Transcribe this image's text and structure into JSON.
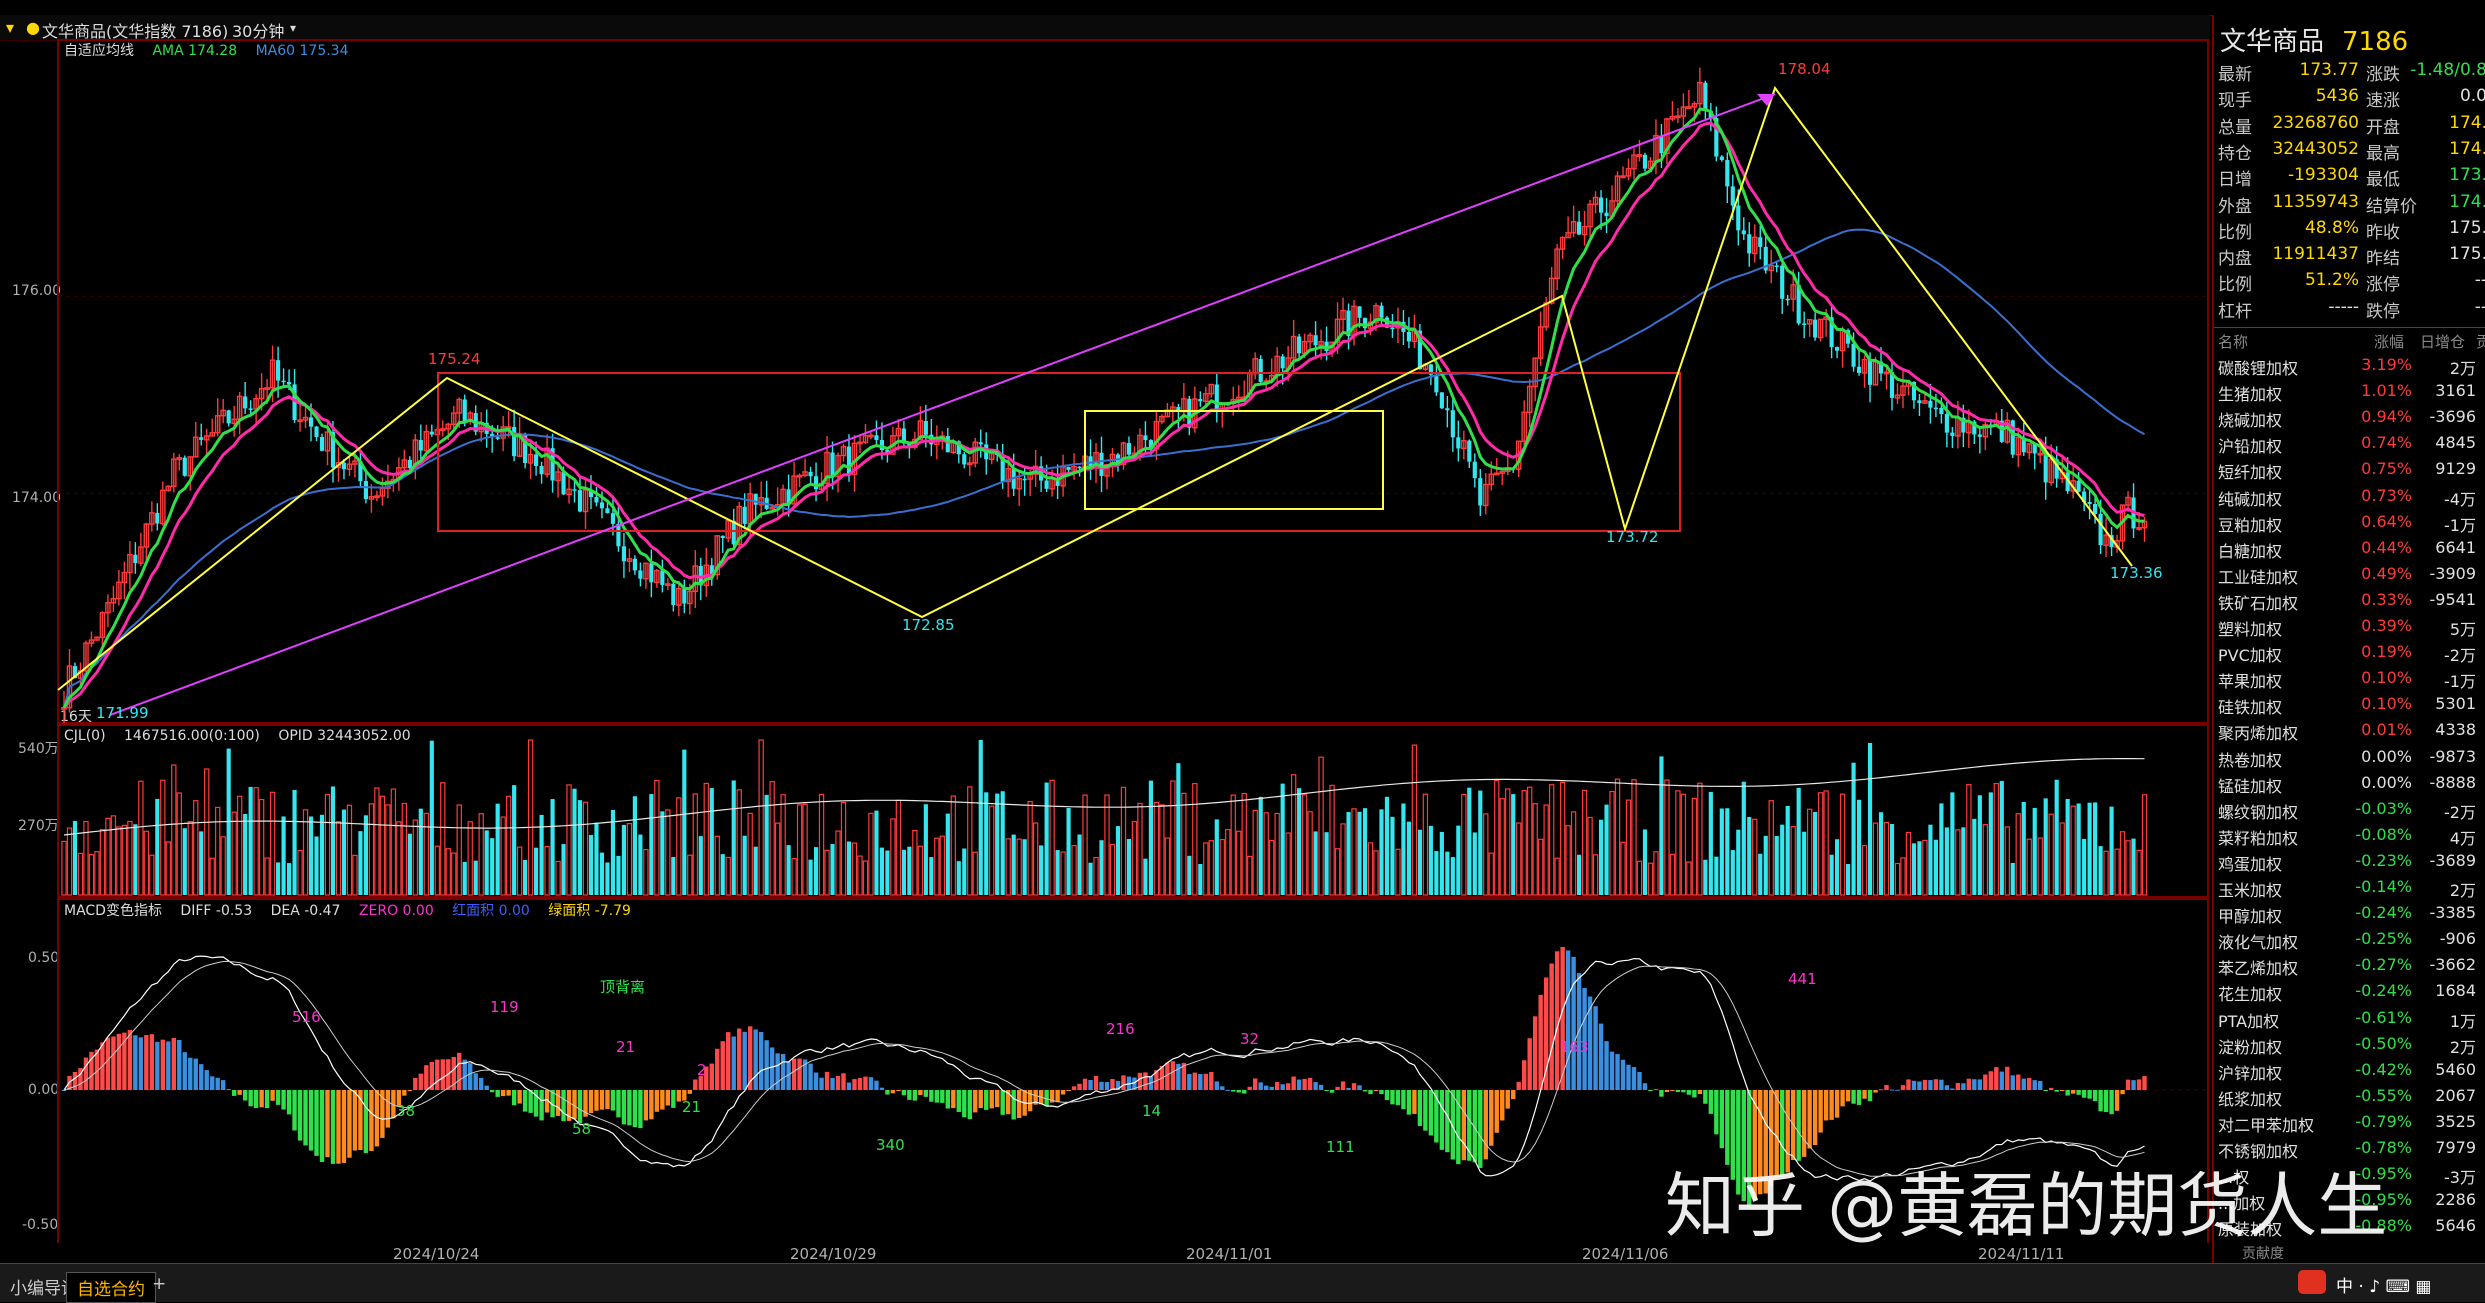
{
  "titlebar": {
    "symbol": "文华商品(文华指数 7186)",
    "period": "30分钟"
  },
  "main_legend": {
    "mode": "自适应均线",
    "ama": "AMA 174.28",
    "ma60": "MA60 175.34"
  },
  "vol_legend": {
    "cjl": "CJL(0)",
    "vol": "1467516.00(0:100)",
    "opid": "OPID 32443052.00"
  },
  "macd_legend": {
    "name": "MACD变色指标",
    "diff": "DIFF -0.53",
    "dea": "DEA -0.47",
    "zero": "ZERO 0.00",
    "red": "红面积 0.00",
    "green": "绿面积 -7.79"
  },
  "price_axis": [
    "176.00",
    "174.00"
  ],
  "vol_axis": [
    "540万",
    "270万"
  ],
  "macd_axis": [
    "0.50",
    "0.00",
    "-0.50"
  ],
  "period_tag": "16天",
  "annotations": {
    "p1": "171.99",
    "p2": "175.24",
    "p3": "172.85",
    "p4": "178.04",
    "p5": "173.72",
    "p6": "173.36",
    "m1": "516",
    "m2": "119",
    "m3": "顶背离",
    "m4": "21",
    "m5": "2",
    "m6": "38",
    "m7": "58",
    "m8": "21",
    "m9": "340",
    "m10": "216",
    "m11": "14",
    "m12": "32",
    "m13": "111",
    "m14": "163",
    "m15": "441"
  },
  "dates": [
    "2024/10/24",
    "2024/10/29",
    "2024/11/01",
    "2024/11/06",
    "2024/11/11"
  ],
  "quote": {
    "title": "文华商品",
    "code": "7186",
    "rows": [
      {
        "l": "最新",
        "v": "173.77",
        "vc": "#ffd800",
        "l2": "涨跌",
        "v2": "-1.48/0.8",
        "v2c": "#2fe04a"
      },
      {
        "l": "现手",
        "v": "5436",
        "vc": "#ffd800",
        "l2": "速涨",
        "v2": "0.0",
        "v2c": "#e0e0e0"
      },
      {
        "l": "总量",
        "v": "23268760",
        "vc": "#ffd800",
        "l2": "开盘",
        "v2": "174.",
        "v2c": "#ffd800"
      },
      {
        "l": "持仓",
        "v": "32443052",
        "vc": "#ffd800",
        "l2": "最高",
        "v2": "174.",
        "v2c": "#ffd800"
      },
      {
        "l": "日增",
        "v": "-193304",
        "vc": "#ffd800",
        "l2": "最低",
        "v2": "173.",
        "v2c": "#2fe04a"
      },
      {
        "l": "外盘",
        "v": "11359743",
        "vc": "#ffd800",
        "l2": "结算价",
        "v2": "174.",
        "v2c": "#2fe04a"
      },
      {
        "l": "比例",
        "v": "48.8%",
        "vc": "#ffd800",
        "l2": "昨收",
        "v2": "175.",
        "v2c": "#e0e0e0"
      },
      {
        "l": "内盘",
        "v": "11911437",
        "vc": "#ffd800",
        "l2": "昨结",
        "v2": "175.",
        "v2c": "#e0e0e0"
      },
      {
        "l": "比例",
        "v": "51.2%",
        "vc": "#ffd800",
        "l2": "涨停",
        "v2": "--",
        "v2c": "#e0e0e0"
      },
      {
        "l": "杠杆",
        "v": "-----",
        "vc": "#e0e0e0",
        "l2": "跌停",
        "v2": "--",
        "v2c": "#e0e0e0"
      }
    ]
  },
  "watchlist": {
    "headers": [
      "名称",
      "涨幅",
      "日增仓",
      "贡"
    ],
    "rows": [
      {
        "n": "碳酸锂加权",
        "c": "3.19%",
        "h": "2万",
        "cc": "#ff3a3a"
      },
      {
        "n": "生猪加权",
        "c": "1.01%",
        "h": "3161",
        "cc": "#ff3a3a"
      },
      {
        "n": "烧碱加权",
        "c": "0.94%",
        "h": "-3696",
        "cc": "#ff3a3a"
      },
      {
        "n": "沪铅加权",
        "c": "0.74%",
        "h": "4845",
        "cc": "#ff3a3a"
      },
      {
        "n": "短纤加权",
        "c": "0.75%",
        "h": "9129",
        "cc": "#ff3a3a"
      },
      {
        "n": "纯碱加权",
        "c": "0.73%",
        "h": "-4万",
        "cc": "#ff3a3a"
      },
      {
        "n": "豆粕加权",
        "c": "0.64%",
        "h": "-1万",
        "cc": "#ff3a3a"
      },
      {
        "n": "白糖加权",
        "c": "0.44%",
        "h": "6641",
        "cc": "#ff3a3a"
      },
      {
        "n": "工业硅加权",
        "c": "0.49%",
        "h": "-3909",
        "cc": "#ff3a3a"
      },
      {
        "n": "铁矿石加权",
        "c": "0.33%",
        "h": "-9541",
        "cc": "#ff3a3a"
      },
      {
        "n": "塑料加权",
        "c": "0.39%",
        "h": "5万",
        "cc": "#ff3a3a"
      },
      {
        "n": "PVC加权",
        "c": "0.19%",
        "h": "-2万",
        "cc": "#ff3a3a"
      },
      {
        "n": "苹果加权",
        "c": "0.10%",
        "h": "-1万",
        "cc": "#ff3a3a"
      },
      {
        "n": "硅铁加权",
        "c": "0.10%",
        "h": "5301",
        "cc": "#ff3a3a"
      },
      {
        "n": "聚丙烯加权",
        "c": "0.01%",
        "h": "4338",
        "cc": "#ff3a3a"
      },
      {
        "n": "热卷加权",
        "c": "0.00%",
        "h": "-9873",
        "cc": "#e0e0e0"
      },
      {
        "n": "锰硅加权",
        "c": "0.00%",
        "h": "-8888",
        "cc": "#e0e0e0"
      },
      {
        "n": "螺纹钢加权",
        "c": "-0.03%",
        "h": "-2万",
        "cc": "#2fe04a"
      },
      {
        "n": "菜籽粕加权",
        "c": "-0.08%",
        "h": "4万",
        "cc": "#2fe04a"
      },
      {
        "n": "鸡蛋加权",
        "c": "-0.23%",
        "h": "-3689",
        "cc": "#2fe04a"
      },
      {
        "n": "玉米加权",
        "c": "-0.14%",
        "h": "2万",
        "cc": "#2fe04a"
      },
      {
        "n": "甲醇加权",
        "c": "-0.24%",
        "h": "-3385",
        "cc": "#2fe04a"
      },
      {
        "n": "液化气加权",
        "c": "-0.25%",
        "h": "-906",
        "cc": "#2fe04a"
      },
      {
        "n": "苯乙烯加权",
        "c": "-0.27%",
        "h": "-3662",
        "cc": "#2fe04a"
      },
      {
        "n": "花生加权",
        "c": "-0.24%",
        "h": "1684",
        "cc": "#2fe04a"
      },
      {
        "n": "PTA加权",
        "c": "-0.61%",
        "h": "1万",
        "cc": "#2fe04a"
      },
      {
        "n": "淀粉加权",
        "c": "-0.50%",
        "h": "2万",
        "cc": "#2fe04a"
      },
      {
        "n": "沪锌加权",
        "c": "-0.42%",
        "h": "5460",
        "cc": "#2fe04a"
      },
      {
        "n": "纸浆加权",
        "c": "-0.55%",
        "h": "2067",
        "cc": "#2fe04a"
      },
      {
        "n": "对二甲苯加权",
        "c": "-0.79%",
        "h": "3525",
        "cc": "#2fe04a"
      },
      {
        "n": "不锈钢加权",
        "c": "-0.78%",
        "h": "7979",
        "cc": "#2fe04a"
      },
      {
        "n": "...权",
        "c": "-0.95%",
        "h": "-3万",
        "cc": "#2fe04a"
      },
      {
        "n": "...加权",
        "c": "-0.95%",
        "h": "2286",
        "cc": "#2fe04a"
      },
      {
        "n": "原装加权",
        "c": "-0.88%",
        "h": "5646",
        "cc": "#2fe04a"
      }
    ],
    "footer": "贡献度"
  },
  "bottom_tabs": [
    "小编导读",
    "自选合约",
    "+"
  ],
  "watermark": "知乎 @黄磊的期货人生",
  "colors": {
    "up": "#ff3a3a",
    "down": "#33e6f0",
    "ama": "#2fe04a",
    "ma": "#ff2aa8",
    "ma60": "#3a6fd0",
    "yellow": "#ffff40",
    "magenta": "#e040ff",
    "box_red": "#e02020"
  },
  "chart_data": {
    "type": "candlestick",
    "title": "文华商品(文华指数 7186) 30分钟",
    "ylabel": "",
    "ylim": [
      171.7,
      178.4
    ],
    "x_dates": [
      "2024/10/24",
      "2024/10/29",
      "2024/11/01",
      "2024/11/06",
      "2024/11/11"
    ],
    "key_points": [
      {
        "label": "171.99",
        "price": 171.99
      },
      {
        "label": "175.24",
        "price": 175.24
      },
      {
        "label": "172.85",
        "price": 172.85
      },
      {
        "label": "178.04",
        "price": 178.04
      },
      {
        "label": "173.72",
        "price": 173.72
      },
      {
        "label": "173.36",
        "price": 173.36
      }
    ],
    "anchors": [
      [
        0,
        172.0
      ],
      [
        8,
        172.8
      ],
      [
        20,
        174.2
      ],
      [
        38,
        175.2
      ],
      [
        46,
        174.6
      ],
      [
        56,
        174.0
      ],
      [
        72,
        174.8
      ],
      [
        86,
        174.4
      ],
      [
        100,
        173.6
      ],
      [
        112,
        172.9
      ],
      [
        124,
        173.8
      ],
      [
        140,
        174.3
      ],
      [
        156,
        174.6
      ],
      [
        176,
        174.1
      ],
      [
        192,
        174.4
      ],
      [
        210,
        175.0
      ],
      [
        230,
        175.6
      ],
      [
        240,
        175.9
      ],
      [
        250,
        175.2
      ],
      [
        258,
        173.9
      ],
      [
        264,
        174.3
      ],
      [
        272,
        176.4
      ],
      [
        288,
        177.4
      ],
      [
        298,
        178.04
      ],
      [
        306,
        176.6
      ],
      [
        316,
        175.9
      ],
      [
        326,
        175.4
      ],
      [
        340,
        174.8
      ],
      [
        354,
        174.6
      ],
      [
        366,
        174.0
      ],
      [
        372,
        173.5
      ],
      [
        376,
        173.8
      ]
    ],
    "volume_range_wan": [
      0,
      540
    ],
    "macd_ylim": [
      -0.55,
      0.6
    ]
  }
}
